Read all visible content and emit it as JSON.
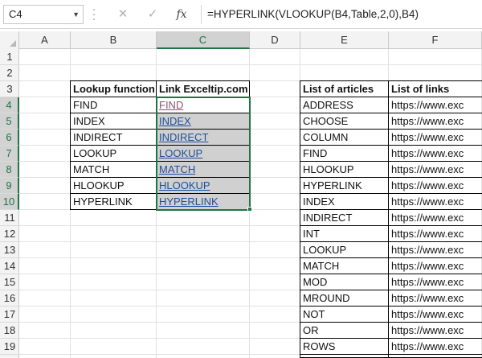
{
  "formula_bar": {
    "name_box": "C4",
    "formula": "=HYPERLINK(VLOOKUP(B4,Table,2,0),B4)",
    "cancel_icon": "cross-icon",
    "enter_icon": "check-icon",
    "function_icon": "fx-icon",
    "fx_label": "fx"
  },
  "columns": [
    "A",
    "B",
    "C",
    "D",
    "E",
    "F"
  ],
  "rows": [
    "1",
    "2",
    "3",
    "4",
    "5",
    "6",
    "7",
    "8",
    "9",
    "10",
    "11",
    "12",
    "13",
    "14",
    "15",
    "16",
    "17",
    "18",
    "19"
  ],
  "lookup_table": {
    "header_function": "Lookup function",
    "header_link": "Link Exceltip.com",
    "rows": [
      {
        "function": "FIND",
        "link": "FIND"
      },
      {
        "function": "INDEX",
        "link": "INDEX"
      },
      {
        "function": "INDIRECT",
        "link": "INDIRECT"
      },
      {
        "function": "LOOKUP",
        "link": "LOOKUP"
      },
      {
        "function": "MATCH",
        "link": "MATCH"
      },
      {
        "function": "HLOOKUP",
        "link": "HLOOKUP"
      },
      {
        "function": "HYPERLINK",
        "link": "HYPERLINK"
      }
    ]
  },
  "articles_table": {
    "header_articles": "List of articles",
    "header_links": "List of links",
    "rows": [
      {
        "article": "ADDRESS",
        "link": "https://www.exc"
      },
      {
        "article": "CHOOSE",
        "link": "https://www.exc"
      },
      {
        "article": "COLUMN",
        "link": "https://www.exc"
      },
      {
        "article": "FIND",
        "link": "https://www.exc"
      },
      {
        "article": "HLOOKUP",
        "link": "https://www.exc"
      },
      {
        "article": "HYPERLINK",
        "link": "https://www.exc"
      },
      {
        "article": "INDEX",
        "link": "https://www.exc"
      },
      {
        "article": "INDIRECT",
        "link": "https://www.exc"
      },
      {
        "article": "INT",
        "link": "https://www.exc"
      },
      {
        "article": "LOOKUP",
        "link": "https://www.exc"
      },
      {
        "article": "MATCH",
        "link": "https://www.exc"
      },
      {
        "article": "MOD",
        "link": "https://www.exc"
      },
      {
        "article": "MROUND",
        "link": "https://www.exc"
      },
      {
        "article": "NOT",
        "link": "https://www.exc"
      },
      {
        "article": "OR",
        "link": "https://www.exc"
      },
      {
        "article": "ROWS",
        "link": "https://www.exc"
      }
    ]
  },
  "colors": {
    "accent": "#217346",
    "link": "#1f4e9c",
    "visited_link": "#954f72",
    "selection_fill": "#d0d0d0"
  }
}
